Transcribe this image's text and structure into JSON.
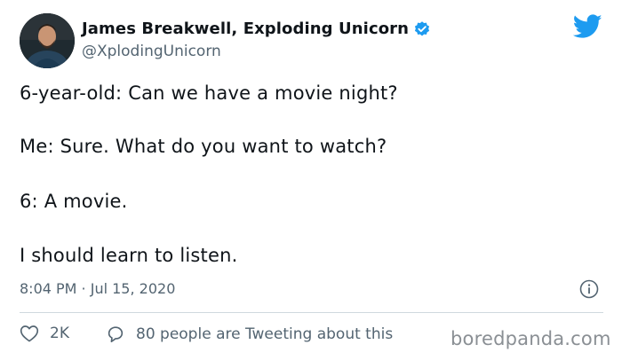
{
  "author": {
    "display_name": "James Breakwell, Exploding Unicorn",
    "handle": "@XplodingUnicorn",
    "verified_icon": "verified-badge-icon",
    "avatar": "avatar"
  },
  "brand": {
    "icon": "twitter-bird-icon",
    "color": "#1d9bf0"
  },
  "tweet": {
    "lines": [
      "6-year-old: Can we have a movie night?",
      "Me: Sure. What do you want to watch?",
      "6: A movie.",
      "I should learn to listen."
    ],
    "timestamp": "8:04 PM · Jul 15, 2020"
  },
  "actions": {
    "likes": "2K",
    "conversation": "80 people are Tweeting about this"
  },
  "watermark": "boredpanda.com",
  "colors": {
    "text": "#0f1419",
    "secondary": "#536471",
    "divider": "#cfd9de"
  }
}
